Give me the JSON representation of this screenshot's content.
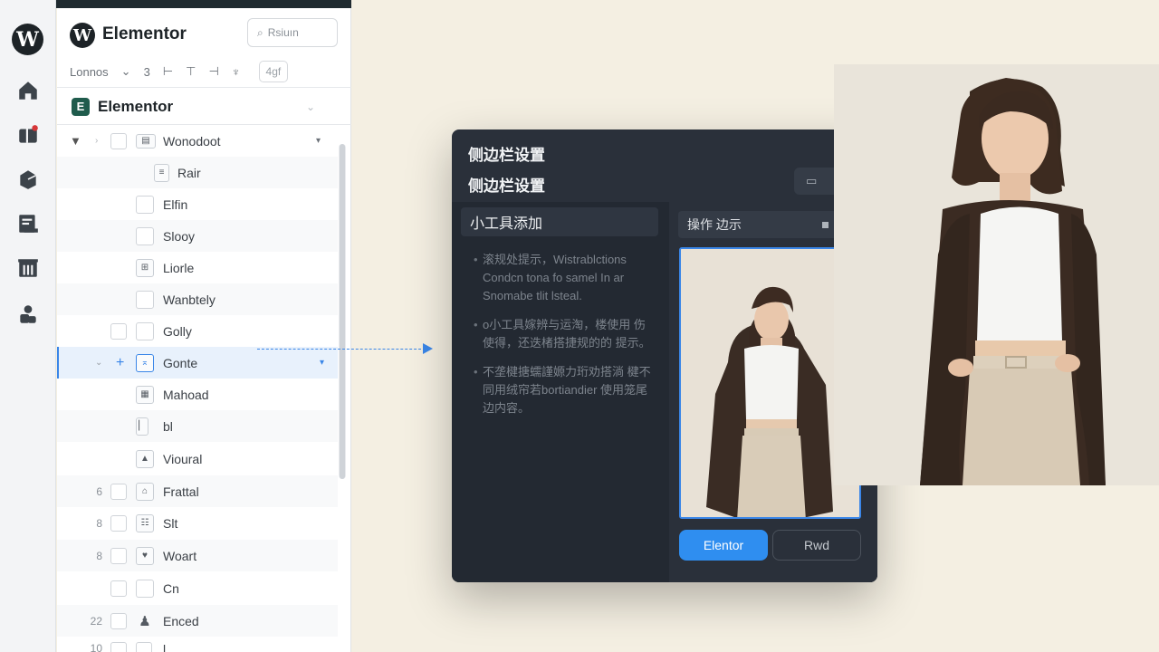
{
  "app": {
    "brand": "Elementor"
  },
  "header": {
    "search_placeholder": "Rsiuın",
    "toolbar": {
      "label": "Lonnos",
      "chev": "⌄",
      "n": "3",
      "t1": "⊢",
      "t2": "⊤",
      "t3": "⊣",
      "t4": "♆",
      "select": "4gf"
    }
  },
  "section": {
    "title": "Elementor"
  },
  "tree": [
    {
      "num": "",
      "label": "Wonodoot"
    },
    {
      "num": "",
      "label": "Rair"
    },
    {
      "num": "",
      "label": "Elfin"
    },
    {
      "num": "",
      "label": "Slooy"
    },
    {
      "num": "",
      "label": "Liorle"
    },
    {
      "num": "",
      "label": "Wanbtely"
    },
    {
      "num": "",
      "label": "Golly"
    },
    {
      "num": "",
      "label": "Gonte"
    },
    {
      "num": "",
      "label": "Mahoad"
    },
    {
      "num": "",
      "label": "bl"
    },
    {
      "num": "",
      "label": "Vioural"
    },
    {
      "num": "6",
      "label": "Frattal"
    },
    {
      "num": "8",
      "label": "Slt"
    },
    {
      "num": "8",
      "label": "Woart"
    },
    {
      "num": "",
      "label": "Cn"
    },
    {
      "num": "22",
      "label": "Enced"
    },
    {
      "num": "10",
      "label": "l"
    }
  ],
  "dialog": {
    "title": "侧边栏设置",
    "subtitle": "侧边栏设置",
    "widget_title": "小工具添加",
    "tips": [
      "滚规处提示，Wistrablctions Condcn tona fo samel In ar Snomabe tlit lsteal.",
      "o小工具嫁辨与运淘，楼使用 伤使得，还迭楮搭捷规的的 提示。",
      "不垄楗搪蠕謹嫄力珩劝搭淌 楗不同用绒帘若bortiandier 使用笼尾边内容。"
    ],
    "op_label": "操作 边示",
    "primary_btn": "Elentor",
    "secondary_btn": "Rwd"
  }
}
